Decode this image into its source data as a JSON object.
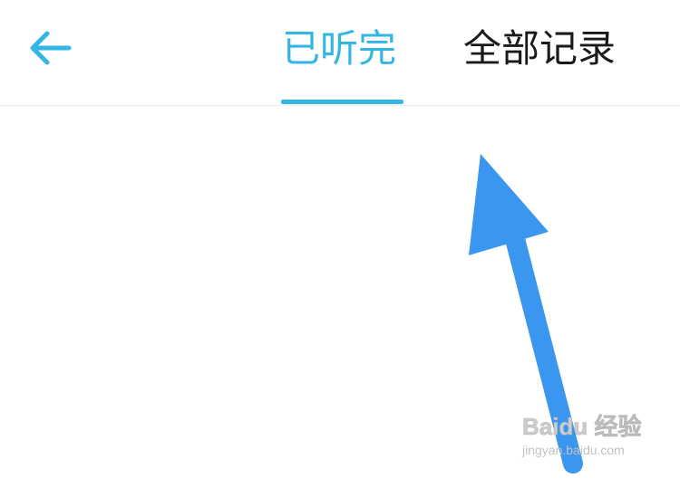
{
  "header": {
    "back_icon": "arrow-left-icon",
    "tabs": [
      {
        "label": "已听完",
        "active": true
      },
      {
        "label": "全部记录",
        "active": false
      }
    ]
  },
  "annotation": {
    "icon": "pointing-arrow-icon"
  },
  "watermark": {
    "brand": "Baidu 经验",
    "url": "jingyan.baidu.com"
  },
  "colors": {
    "accent": "#34b6e4",
    "text": "#1a1a1a",
    "annotation_arrow": "#3a96ee",
    "divider": "#eeeeee",
    "watermark": "#cccccc"
  }
}
